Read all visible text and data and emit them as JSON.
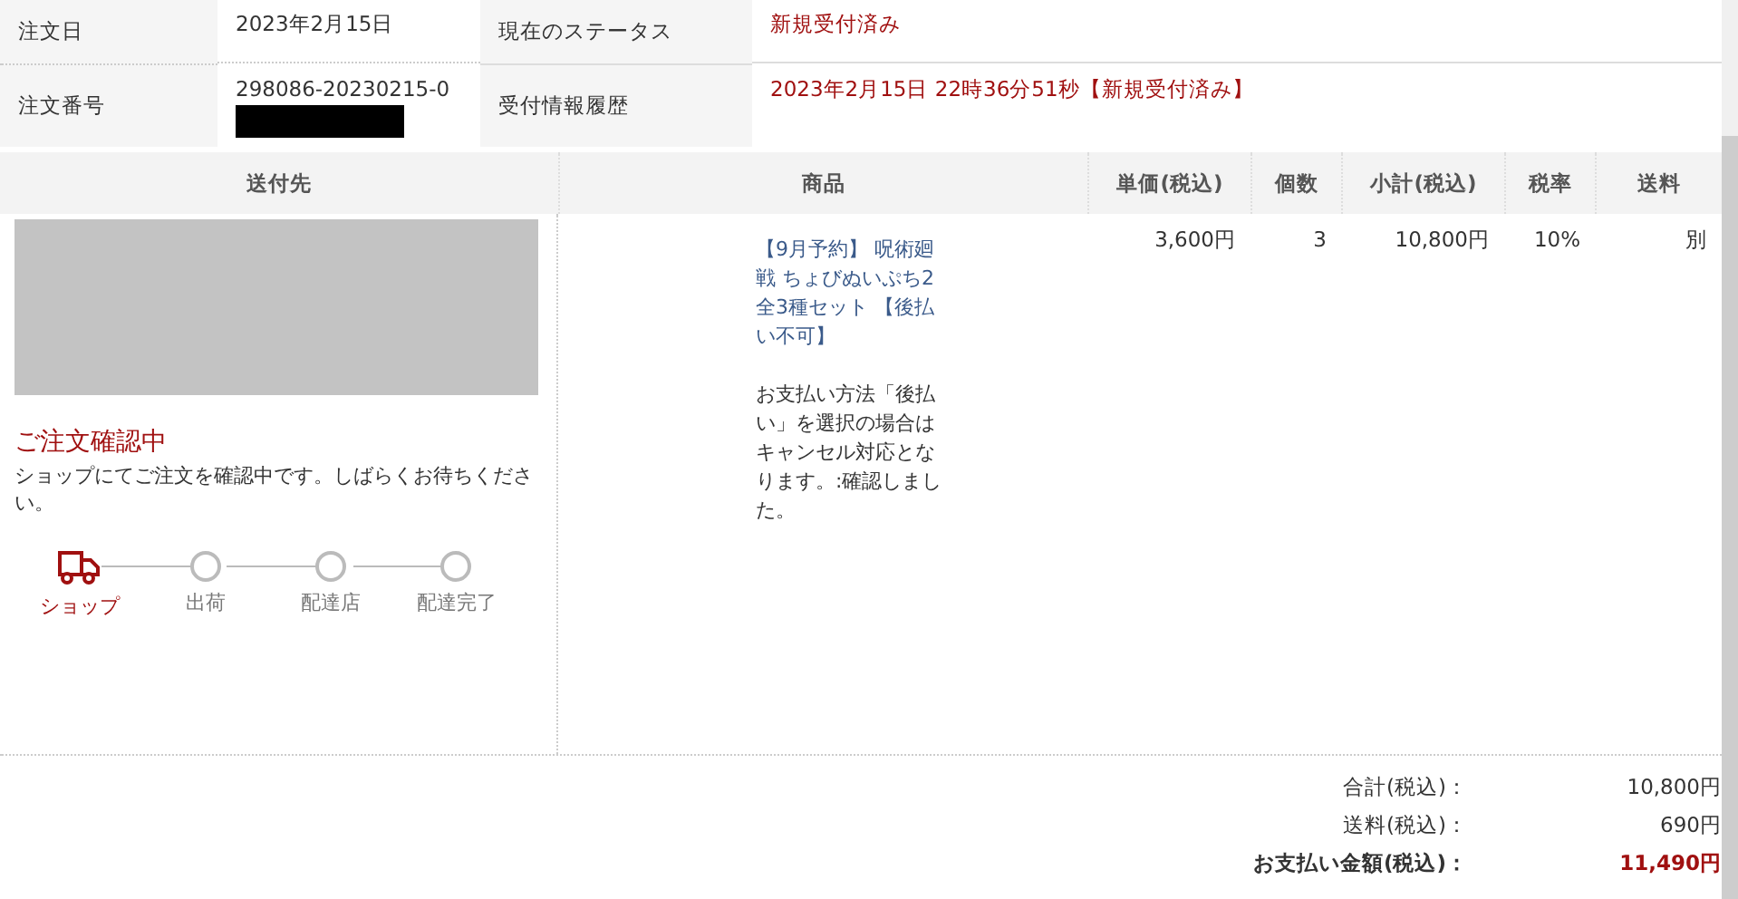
{
  "order_info": [
    {
      "label": "注文日",
      "value": "2023年2月15日",
      "redacted": false,
      "label2": "現在のステータス",
      "value2": "新規受付済み"
    },
    {
      "label": "注文番号",
      "value": "298086-20230215-0",
      "redacted": true,
      "label2": "受付情報履歴",
      "value2": "2023年2月15日 22時36分51秒【新規受付済み】"
    }
  ],
  "table": {
    "columns": [
      "送付先",
      "商品",
      "単価(税込)",
      "個数",
      "小計(税込)",
      "税率",
      "送料"
    ],
    "shipping": {
      "status_title": "ご注文確認中",
      "status_message": "ショップにてご注文を確認中です。しばらくお待ちください。",
      "steps": [
        {
          "label": "ショップ",
          "current": true
        },
        {
          "label": "出荷",
          "current": false
        },
        {
          "label": "配達店",
          "current": false
        },
        {
          "label": "配達完了",
          "current": false
        }
      ]
    },
    "item": {
      "name": "【9月予約】 呪術廻戦 ちょびぬいぷち2 全3種セット 【後払い不可】",
      "note": "お支払い方法「後払い」を選択の場合はキャンセル対応となります。:確認しました。",
      "unit_price": "3,600円",
      "quantity": "3",
      "subtotal": "10,800円",
      "tax_rate": "10%",
      "shipping": "別"
    }
  },
  "totals": [
    {
      "label": "合計(税込)：",
      "value": "10,800円",
      "emphasis": false
    },
    {
      "label": "送料(税込)：",
      "value": "690円",
      "emphasis": false
    },
    {
      "label": "お支払い金額(税込)：",
      "value": "11,490円",
      "emphasis": true
    }
  ]
}
